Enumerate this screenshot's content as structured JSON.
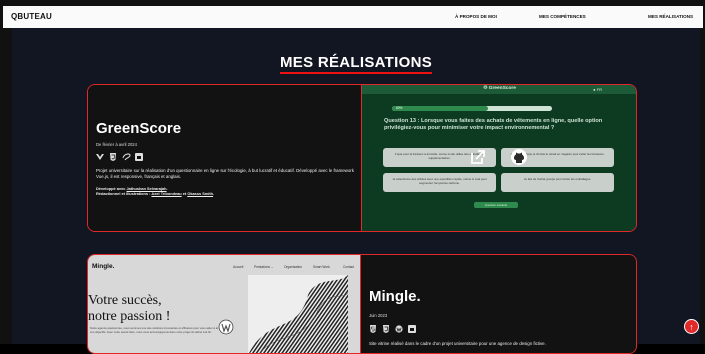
{
  "header": {
    "brand": "QBUTEAU",
    "nav": [
      "À PROPOS DE MOI",
      "MES COMPÉTENCES",
      "MES RÉALISATIONS"
    ]
  },
  "section": {
    "title": "MES RÉALISATIONS"
  },
  "projects": [
    {
      "title": "GreenScore",
      "date": "De février à avril 2024",
      "tech_icons": [
        "vuejs-icon",
        "css3-icon",
        "sass-icon",
        "photoshop-icon"
      ],
      "description": "Projet universitaire sur la réalisation d'un questionnaire en ligne sur l'écologie, à but lucratif et éducatif. Développé avec le framework Vue.js, il est responsive, français et anglais.",
      "credits_line1_prefix": "Développé avec ",
      "credits_line1_name": "Jathushan Selvarajah",
      "credits_line1_suffix": ".",
      "credits_line2_prefix": "Rédactionnel et illustrations : ",
      "credits_line2_name1": "Axel Tribondeau",
      "credits_line2_mid": " et ",
      "credits_line2_name2": "Okasss Smith",
      "credits_line2_suffix": ".",
      "preview": {
        "app_name": "♲ GreenScore",
        "lang": "● FR",
        "progress_label": "60%",
        "progress": 0.6,
        "question": "Question 13 : Lorsque vous faites des achats de vêtements en ligne, quelle option privilégiez-vous pour minimiser votre impact environnemental ?",
        "options": [
          "J'opte pour la livraison à domicile, même si elle utilise des emballages supplémentaires.",
          "J'achète en ligne et choisis le retrait en magasin pour éviter les livraisons.",
          "Je sélectionne des articles avec une expédition rapide, même si cela peut augmenter l'empreinte carbone.",
          "Je fais de l'achat groupé pour limiter les emballages."
        ],
        "button": "Question suivante"
      }
    },
    {
      "title": "Mingle.",
      "date": "Juin 2023",
      "tech_icons": [
        "html5-icon",
        "css3-icon",
        "wordpress-icon",
        "photoshop-icon"
      ],
      "description": "Site vitrine réalisé dans le cadre d'un projet universitaire pour une agence de design fictive.",
      "preview": {
        "brand": "Mingle.",
        "nav": [
          "Accueil",
          "Prestations ⌄",
          "Organisation",
          "Smart Work",
          "Contact"
        ],
        "hero_line1": "Votre succès,",
        "hero_line2": "notre passion !",
        "hero_sub": "Notre agence passionnée, nous sommes une des solutions innovantes et efficaces pour vous aider à atteindre vos objectifs. Avec notre savoir-faire, nous vous accompagnons dans votre projet du début à la fin."
      }
    }
  ],
  "scroll_top_label": "↑",
  "colors": {
    "accent": "#e12929",
    "greenscore_bg": "#0d3b22",
    "page_bg": "#121622"
  }
}
